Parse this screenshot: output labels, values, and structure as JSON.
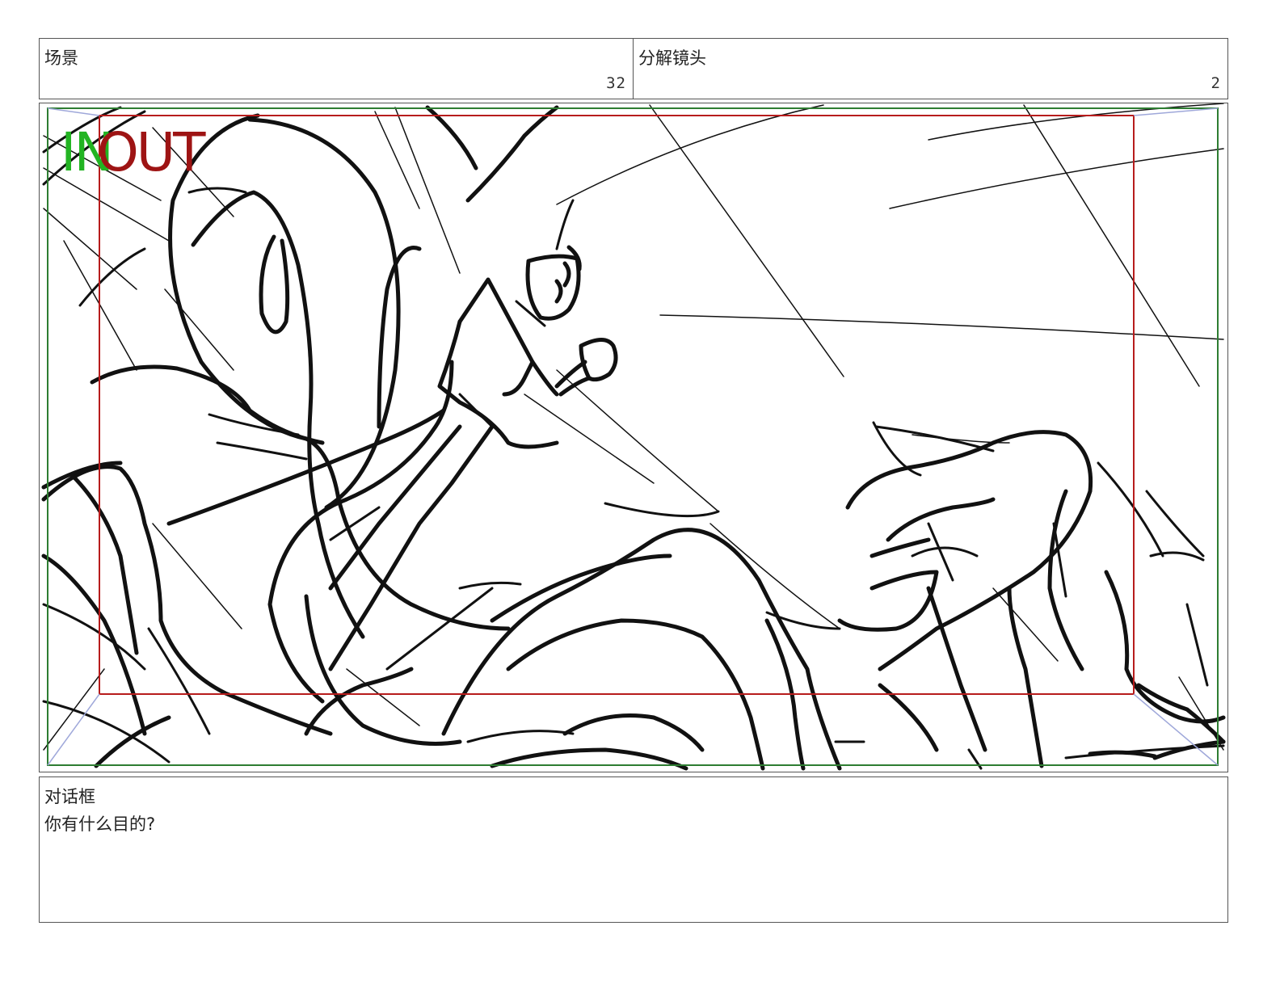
{
  "header": {
    "scene_label": "场景",
    "scene_number": "32",
    "shot_label": "分解镜头",
    "shot_number": "2"
  },
  "panel": {
    "in_marker": "IN",
    "out_marker": "OUT",
    "colors": {
      "safe_frame": "#2e7d32",
      "action_frame": "#b71c1c",
      "in_text": "#22b422",
      "out_text": "#9e1414",
      "sketch_stroke": "#111111"
    }
  },
  "dialog": {
    "label": "对话框",
    "text": "你有什么目的?"
  }
}
